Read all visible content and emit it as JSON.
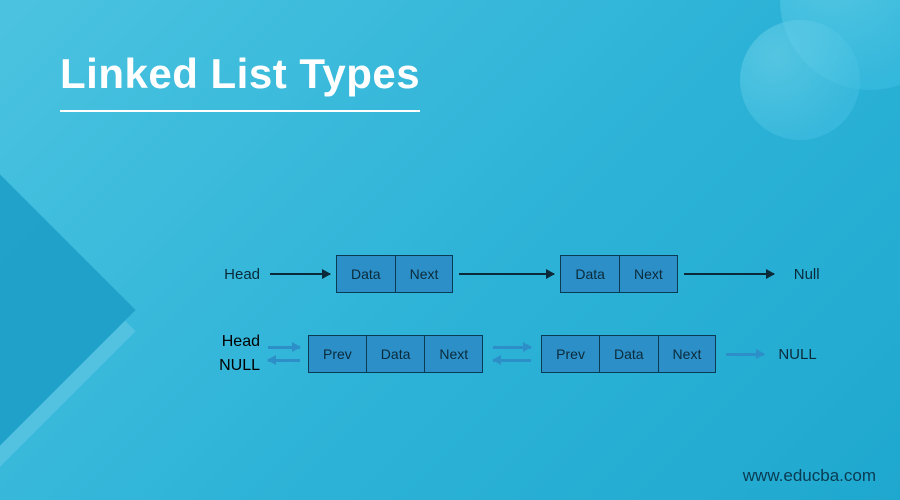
{
  "title": "Linked List Types",
  "footer": "www.educba.com",
  "singly": {
    "head_label": "Head",
    "null_label": "Null",
    "node1": {
      "data": "Data",
      "next": "Next"
    },
    "node2": {
      "data": "Data",
      "next": "Next"
    }
  },
  "doubly": {
    "head_label": "Head",
    "null_left_label": "NULL",
    "null_right_label": "NULL",
    "node1": {
      "prev": "Prev",
      "data": "Data",
      "next": "Next"
    },
    "node2": {
      "prev": "Prev",
      "data": "Data",
      "next": "Next"
    }
  }
}
